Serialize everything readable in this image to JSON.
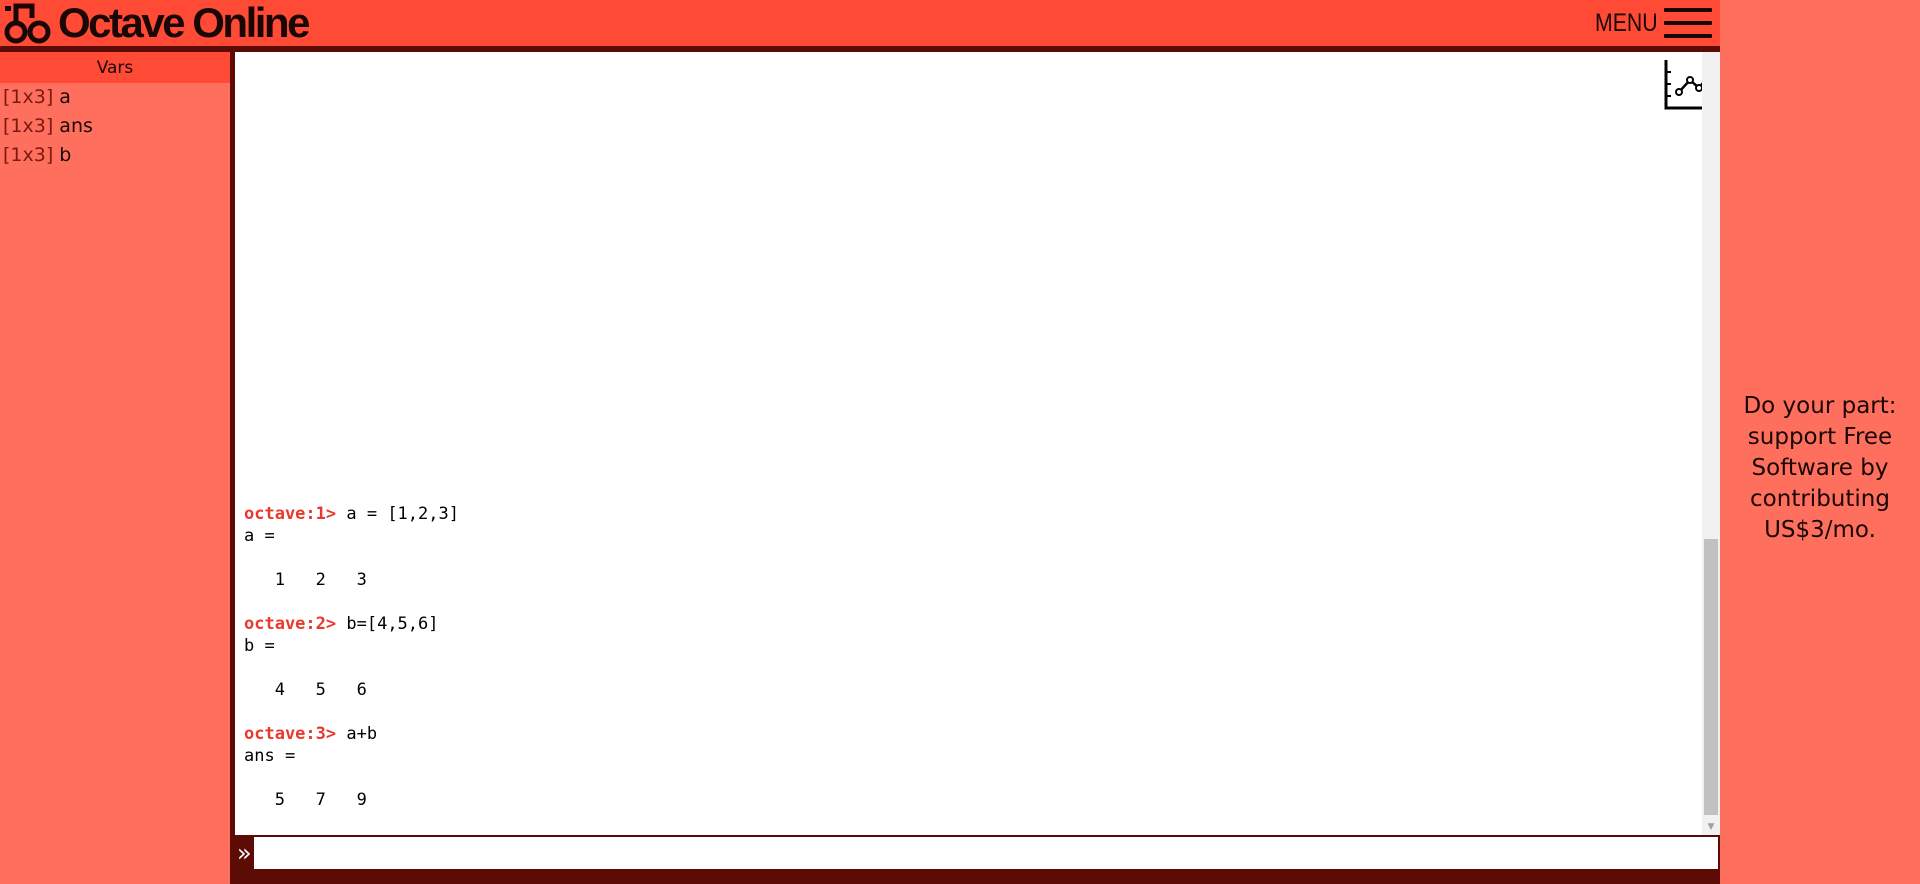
{
  "app": {
    "name": "Octave Online",
    "accent_color": "#ff4b36",
    "dark_color": "#5c0c05",
    "prompt_color": "#e8392c"
  },
  "header": {
    "logo_text": "Octave Online",
    "menu_label": "MENU"
  },
  "vars": {
    "title": "Vars",
    "items": [
      {
        "size": "[1x3]",
        "name": "a"
      },
      {
        "size": "[1x3]",
        "name": "ans"
      },
      {
        "size": "[1x3]",
        "name": "b"
      }
    ]
  },
  "console": {
    "entries": [
      {
        "prompt": "octave:1>",
        "command": "a = [1,2,3]",
        "result_name": "a =",
        "result_values": "   1   2   3"
      },
      {
        "prompt": "octave:2>",
        "command": "b=[4,5,6]",
        "result_name": "b =",
        "result_values": "   4   5   6"
      },
      {
        "prompt": "octave:3>",
        "command": "a+b",
        "result_name": "ans =",
        "result_values": "   5   7   9"
      }
    ],
    "plot_icon": "plot-chart-icon",
    "input_arrow": "»",
    "input_value": ""
  },
  "promo": {
    "text": "Do your part: support Free Software by contributing US$3/mo."
  }
}
